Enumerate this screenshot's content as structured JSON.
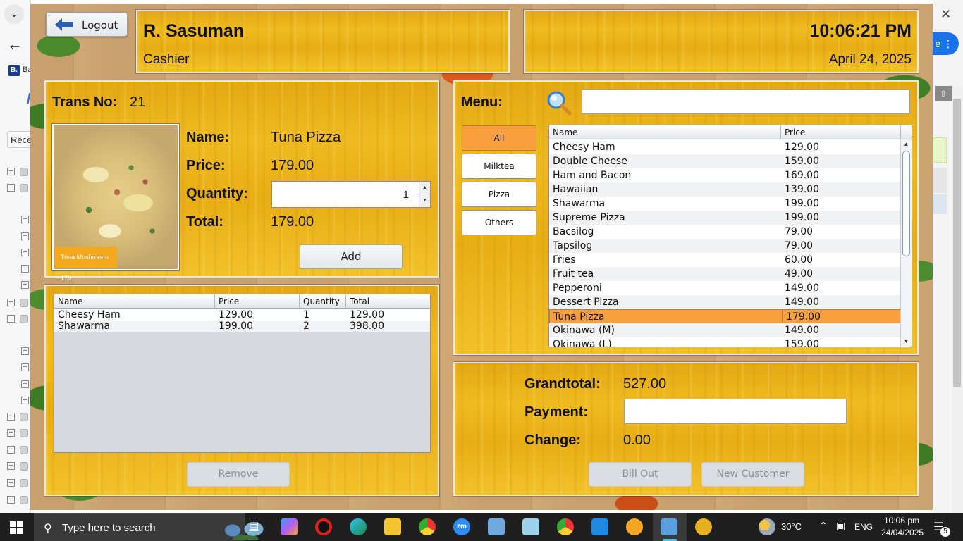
{
  "background_browser": {
    "favorite_badge": "B.",
    "favorite_text": "Ba",
    "recent_tab": "Rece",
    "right_pill": "e ⋮"
  },
  "header": {
    "logout_label": "Logout",
    "user_name": "R. Sasuman",
    "user_role": "Cashier",
    "time": "10:06:21 PM",
    "date": "April 24, 2025"
  },
  "item": {
    "trans_label": "Trans No:",
    "trans_no": "21",
    "name_label": "Name:",
    "name": "Tuna Pizza",
    "price_label": "Price:",
    "price": "179.00",
    "quantity_label": "Quantity:",
    "quantity": "1",
    "total_label": "Total:",
    "total": "179.00",
    "image_tag": "Tuna Mushroom-179",
    "add_label": "Add"
  },
  "order": {
    "columns": [
      "Name",
      "Price",
      "Quantity",
      "Total"
    ],
    "rows": [
      [
        "Cheesy Ham",
        "129.00",
        "1",
        "129.00"
      ],
      [
        "Shawarma",
        "199.00",
        "2",
        "398.00"
      ]
    ],
    "remove_label": "Remove"
  },
  "menu": {
    "label": "Menu:",
    "search_value": "",
    "categories": [
      "All",
      "Milktea",
      "Pizza",
      "Others"
    ],
    "active_category": "All",
    "columns": [
      "Name",
      "Price"
    ],
    "rows": [
      [
        "Cheesy Ham",
        "129.00"
      ],
      [
        "Double Cheese",
        "159.00"
      ],
      [
        "Ham and Bacon",
        "169.00"
      ],
      [
        "Hawaiian",
        "139.00"
      ],
      [
        "Shawarma",
        "199.00"
      ],
      [
        "Supreme Pizza",
        "199.00"
      ],
      [
        "Bacsilog",
        "79.00"
      ],
      [
        "Tapsilog",
        "79.00"
      ],
      [
        "Fries",
        "60.00"
      ],
      [
        "Fruit tea",
        "49.00"
      ],
      [
        "Pepperoni",
        "149.00"
      ],
      [
        "Dessert Pizza",
        "149.00"
      ],
      [
        "Tuna Pizza",
        "179.00"
      ],
      [
        "Okinawa (M)",
        "149.00"
      ],
      [
        "Okinawa (L)",
        "159.00"
      ]
    ],
    "selected_row": "Tuna Pizza",
    "selected_color": "#f8a040"
  },
  "checkout": {
    "grandtotal_label": "Grandtotal:",
    "grandtotal": "527.00",
    "payment_label": "Payment:",
    "payment_value": "",
    "change_label": "Change:",
    "change": "0.00",
    "billout_label": "Bill Out",
    "newcustomer_label": "New Customer"
  },
  "taskbar": {
    "search_placeholder": "Type here to search",
    "weather": "30°C",
    "language": "ENG",
    "clock_time": "10:06 pm",
    "clock_date": "24/04/2025",
    "notification_count": "5",
    "apps": [
      "task-view",
      "copilot",
      "opera",
      "edge",
      "file-explorer",
      "chrome",
      "zoom",
      "monitor",
      "notepad",
      "chrome-profile",
      "vscode",
      "vpn",
      "java-app",
      "game"
    ]
  }
}
